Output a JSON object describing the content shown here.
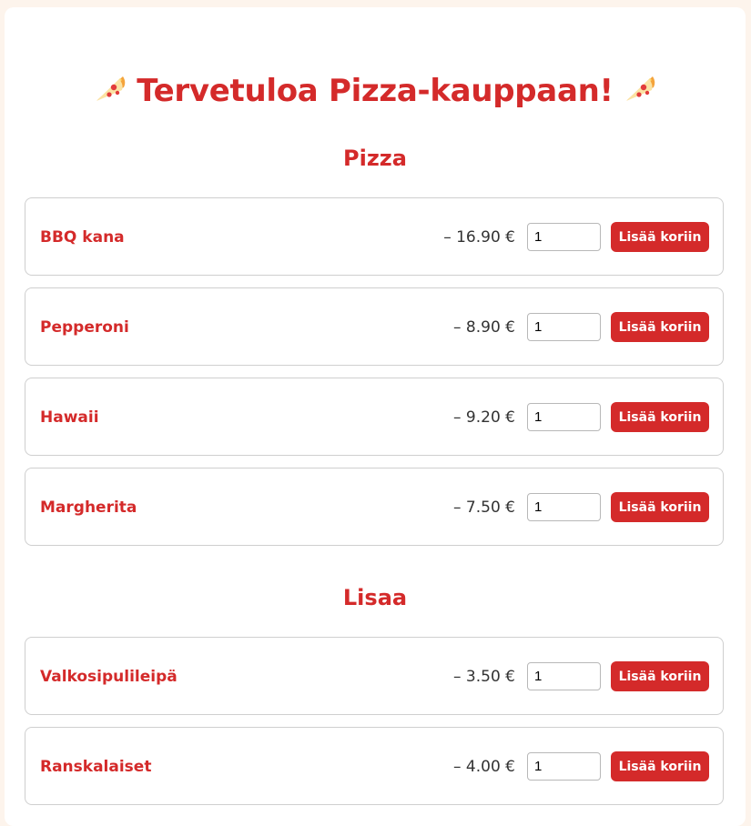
{
  "header": {
    "title": "Tervetuloa Pizza-kauppaan!"
  },
  "sections": [
    {
      "title": "Pizza",
      "items": [
        {
          "name": "BBQ kana",
          "price": "– 16.90 €",
          "quantity": "1",
          "button": "Lisää koriin"
        },
        {
          "name": "Pepperoni",
          "price": "– 8.90 €",
          "quantity": "1",
          "button": "Lisää koriin"
        },
        {
          "name": "Hawaii",
          "price": "– 9.20 €",
          "quantity": "1",
          "button": "Lisää koriin"
        },
        {
          "name": "Margherita",
          "price": "– 7.50 €",
          "quantity": "1",
          "button": "Lisää koriin"
        }
      ]
    },
    {
      "title": "Lisaa",
      "items": [
        {
          "name": "Valkosipulileipä",
          "price": "– 3.50 €",
          "quantity": "1",
          "button": "Lisää koriin"
        },
        {
          "name": "Ranskalaiset",
          "price": "– 4.00 €",
          "quantity": "1",
          "button": "Lisää koriin"
        }
      ]
    }
  ],
  "colors": {
    "accent": "#d42a2a",
    "background": "#fdf4ec",
    "card": "#ffffff"
  },
  "icons": {
    "title_icon": "pizza-slice-icon"
  }
}
